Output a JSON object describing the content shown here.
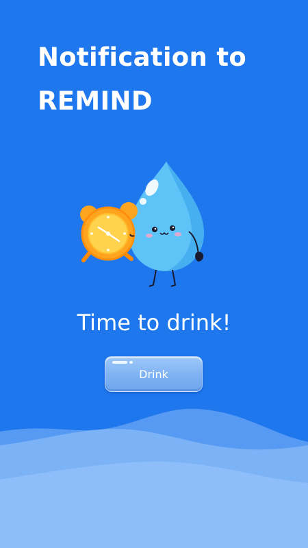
{
  "headline": {
    "line1": "Notification to",
    "line2": "REMIND"
  },
  "prompt": "Time to drink!",
  "drink_button": {
    "label": "Drink"
  },
  "colors": {
    "background": "#1f77ee",
    "drop": "#5cc0f5",
    "clock": "#ffa41f",
    "wave_light": "#8dbdf8"
  },
  "illustration": {
    "icon": "water-drop-with-alarm-clock"
  }
}
